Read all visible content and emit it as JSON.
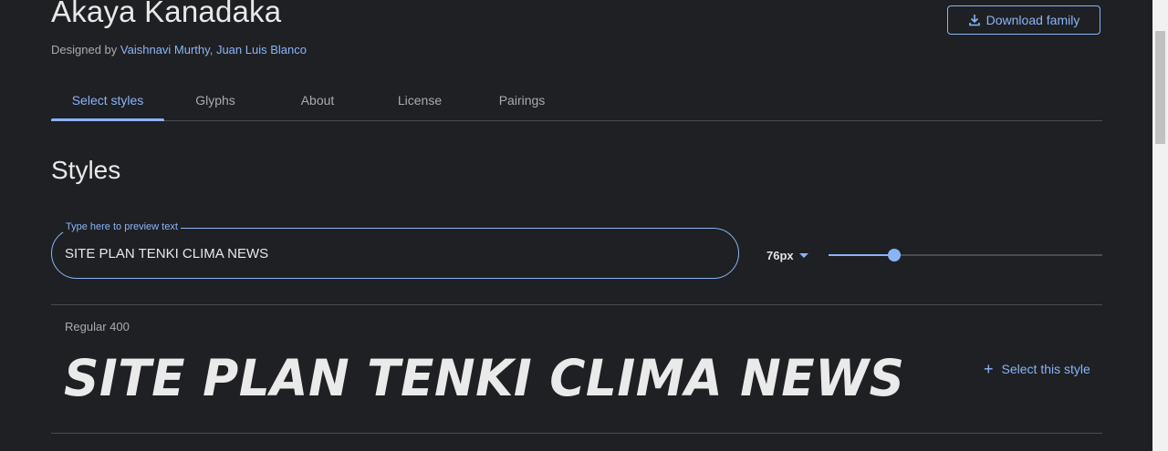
{
  "header": {
    "family_name": "Akaya Kanadaka",
    "designed_by_prefix": "Designed by",
    "designer_1": "Vaishnavi Murthy",
    "designer_separator": ",",
    "designer_2": "Juan Luis Blanco",
    "download_label": "Download family",
    "download_icon": "download-icon"
  },
  "tabs": [
    {
      "label": "Select styles",
      "active": true
    },
    {
      "label": "Glyphs",
      "active": false
    },
    {
      "label": "About",
      "active": false
    },
    {
      "label": "License",
      "active": false
    },
    {
      "label": "Pairings",
      "active": false
    }
  ],
  "styles_section": {
    "heading": "Styles",
    "preview_field": {
      "label": "Type here to preview text",
      "value": "SITE PLAN TENKI CLIMA NEWS"
    },
    "size_select": {
      "value": "76px",
      "icon": "caret-down-icon"
    },
    "size_slider": {
      "fill_fraction": 0.24
    },
    "styles": [
      {
        "name": "Regular 400",
        "preview": "SITE PLAN TENKI CLIMA NEWS",
        "action_label": "Select this style",
        "action_icon": "plus-icon"
      }
    ]
  },
  "colors": {
    "background": "#1f2023",
    "accent": "#8ab4f8",
    "text_primary": "#e8e8e8",
    "text_secondary": "#a8abb0",
    "divider": "#4a4c50"
  }
}
